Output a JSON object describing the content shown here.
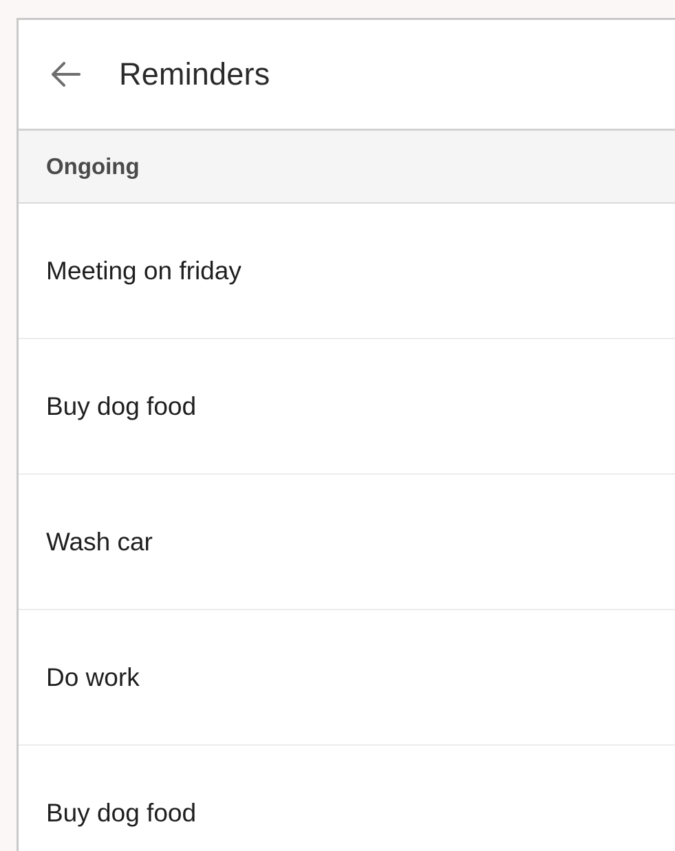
{
  "appbar": {
    "back_icon": "arrow-left-icon",
    "title": "Reminders"
  },
  "section": {
    "title": "Ongoing"
  },
  "reminders": [
    {
      "label": "Meeting on friday"
    },
    {
      "label": "Buy dog food"
    },
    {
      "label": "Wash car"
    },
    {
      "label": "Do work"
    },
    {
      "label": "Buy dog food"
    }
  ]
}
